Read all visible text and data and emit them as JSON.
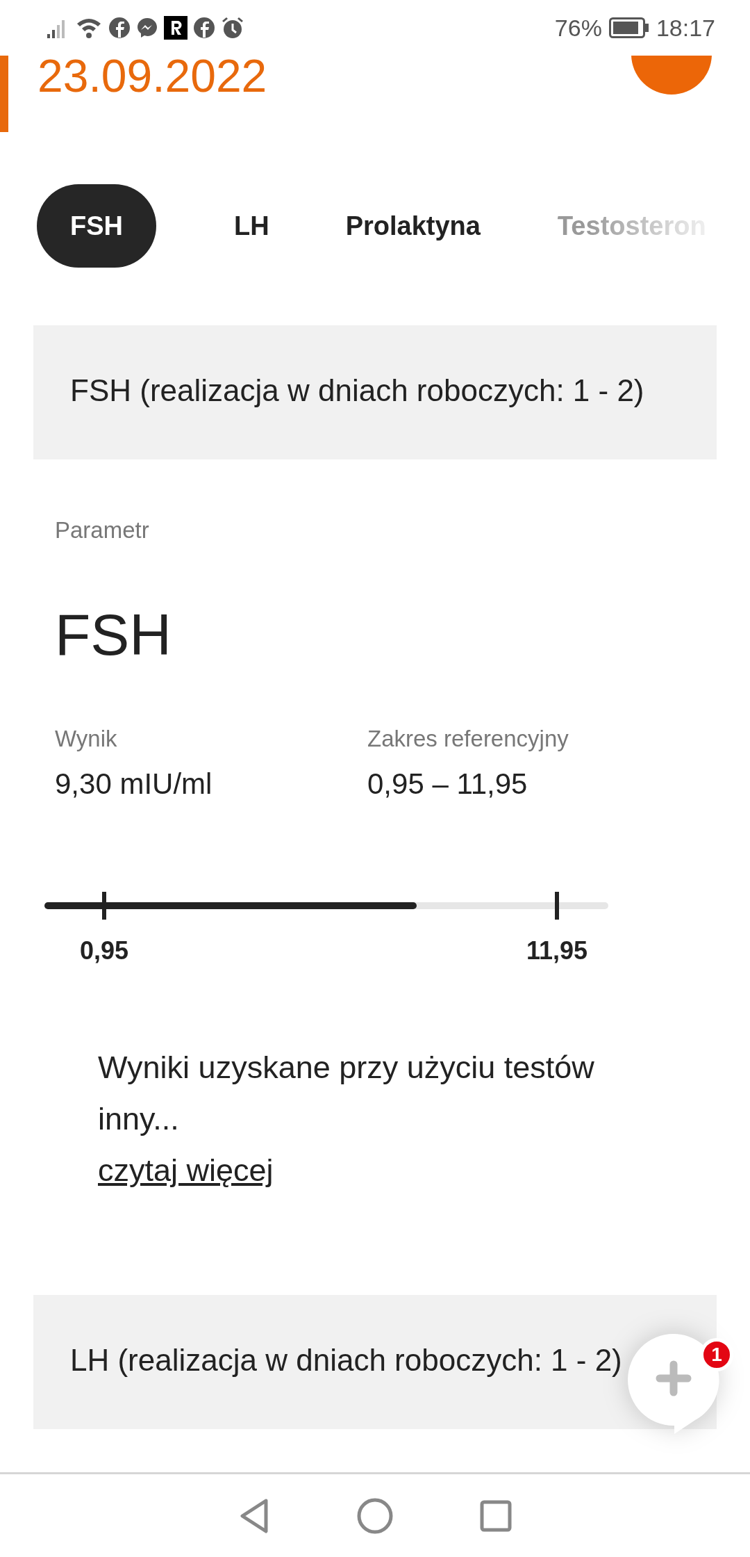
{
  "status_bar": {
    "battery": "76%",
    "time": "18:17"
  },
  "header": {
    "date": "23.09.2022"
  },
  "tabs": [
    {
      "label": "FSH",
      "selected": true
    },
    {
      "label": "LH",
      "selected": false
    },
    {
      "label": "Prolaktyna",
      "selected": false
    },
    {
      "label": "Testosteron",
      "selected": false
    }
  ],
  "sections": [
    {
      "title": "FSH (realizacja w dniach roboczych: 1 - 2)",
      "parameter_label": "Parametr",
      "parameter": "FSH",
      "result_label": "Wynik",
      "result": "9,30 mIU/ml",
      "range_label": "Zakres referencyjny",
      "range": "0,95 – 11,95",
      "scale": {
        "level": 0.66,
        "min_label": "0,95",
        "max_label": "11,95"
      },
      "note": "Wyniki uzyskane przy użyciu testów inny...",
      "link": "czytaj więcej"
    },
    {
      "title": "LH (realizacja w dniach roboczych: 1 - 2)"
    }
  ],
  "fab": {
    "badge": "1"
  }
}
